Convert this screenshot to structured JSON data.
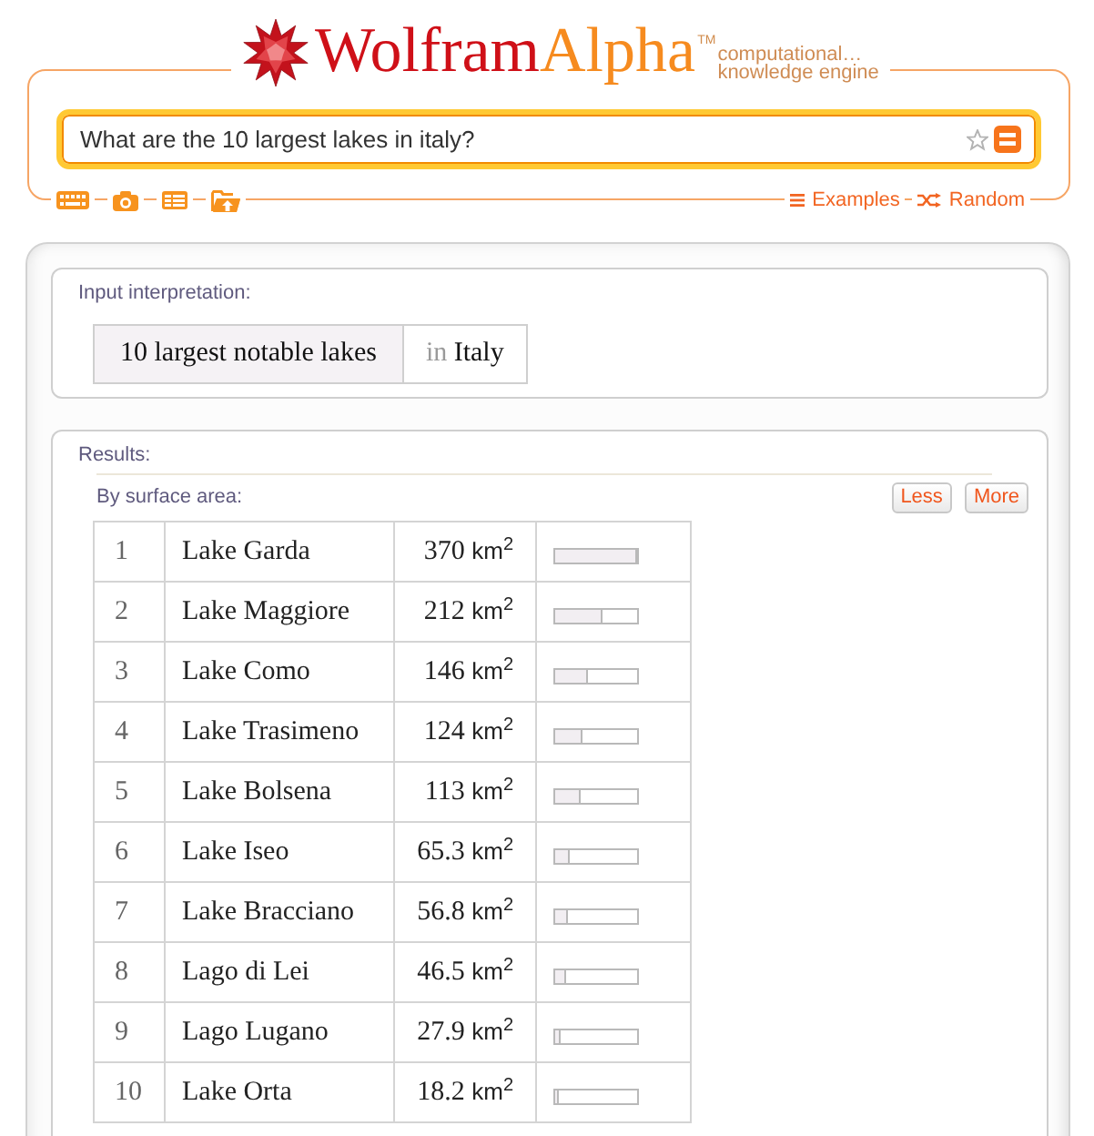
{
  "logo": {
    "wordmark": [
      "Wolfram",
      "Alpha"
    ],
    "trademark": "TM",
    "tagline": [
      "computational…",
      "knowledge engine"
    ]
  },
  "search": {
    "value": "What are the 10 largest lakes in italy?"
  },
  "links": [
    {
      "kind": "examples",
      "label": "Examples"
    },
    {
      "kind": "random",
      "label": "Random"
    }
  ],
  "interpretation": {
    "label": "Input interpretation:",
    "query": "10 largest notable lakes",
    "connector": "in",
    "place": "Italy"
  },
  "results": {
    "label": "Results:",
    "subtitle": "By surface area:",
    "buttons": [
      "Less",
      "More"
    ],
    "rows": [
      {
        "rank": "1",
        "name": "Lake Garda",
        "area": "370",
        "unit": "km$^{2}$",
        "level": 1.0
      },
      {
        "rank": "2",
        "name": "Lake Maggiore",
        "area": "212",
        "unit": "km$^{2}$",
        "level": 0.573
      },
      {
        "rank": "3",
        "name": "Lake Como",
        "area": "146",
        "unit": "km$^{2}$",
        "level": 0.395
      },
      {
        "rank": "4",
        "name": "Lake Trasimeno",
        "area": "124",
        "unit": "km$^{2}$",
        "level": 0.335
      },
      {
        "rank": "5",
        "name": "Lake Bolsena",
        "area": "113",
        "unit": "km$^{2}$",
        "level": 0.305
      },
      {
        "rank": "6",
        "name": "Lake Iseo",
        "area": "65.3",
        "unit": "km$^{2}$",
        "level": 0.176
      },
      {
        "rank": "7",
        "name": "Lake Bracciano",
        "area": "56.8",
        "unit": "km$^{2}$",
        "level": 0.154
      },
      {
        "rank": "8",
        "name": "Lago di Lei",
        "area": "46.5",
        "unit": "km$^{2}$",
        "level": 0.126
      },
      {
        "rank": "9",
        "name": "Lago Lugano",
        "area": "27.9",
        "unit": "km$^{2}$",
        "level": 0.075
      },
      {
        "rank": "10",
        "name": "Lake Orta",
        "area": "18.2",
        "unit": "km$^{2}$",
        "level": 0.049
      }
    ]
  }
}
